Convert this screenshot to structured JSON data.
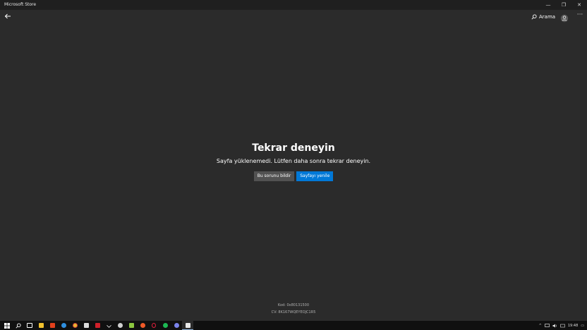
{
  "window": {
    "title": "Microsoft Store",
    "controls": {
      "minimize": "—",
      "restore": "❐",
      "close": "✕"
    }
  },
  "nav": {
    "search_label": "Arama",
    "more_label": "···"
  },
  "error": {
    "heading": "Tekrar deneyin",
    "message": "Sayfa yüklenemedi. Lütfen daha sonra tekrar deneyin.",
    "report_button": "Bu sorunu bildir",
    "refresh_button": "Sayfayı yenile",
    "code": "Kod: 0x80131500",
    "cv": "CV: 8K167WQEYEOJC1R5"
  },
  "taskbar": {
    "icons": [
      "start-icon",
      "search-icon",
      "task-view-icon",
      "file-explorer-icon",
      "office-icon",
      "edge-icon",
      "chrome-icon",
      "mail-icon",
      "app-red-icon",
      "app-arrow-icon",
      "app-settings-icon",
      "app-green-icon",
      "app-orange-icon",
      "app-opera-icon",
      "spotify-icon",
      "app-purple-icon",
      "store-icon"
    ],
    "clock": "19:48",
    "tray_chevron": "^",
    "notification": "▭"
  },
  "colors": {
    "background": "#2b2b2b",
    "titlebar": "#1f1f1f",
    "accent": "#0078d7",
    "secondary_button": "#525252",
    "taskbar": "#101010"
  }
}
